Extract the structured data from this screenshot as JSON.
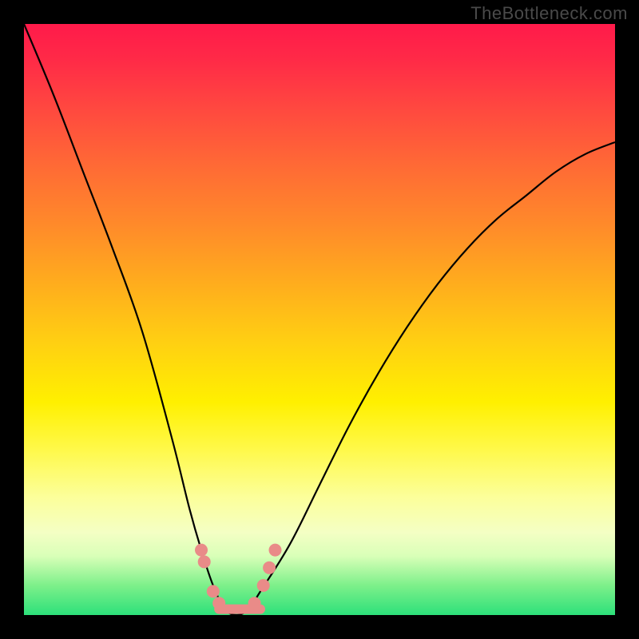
{
  "watermark": "TheBottleneck.com",
  "chart_data": {
    "type": "line",
    "title": "",
    "xlabel": "",
    "ylabel": "",
    "xlim": [
      0,
      100
    ],
    "ylim": [
      0,
      100
    ],
    "grid": false,
    "legend": false,
    "background_gradient": {
      "type": "vertical",
      "top_color": "#ff1a4a",
      "bottom_color": "#2de07a",
      "description": "red-orange-yellow-green heat gradient (top=high bottleneck, bottom=low)"
    },
    "series": [
      {
        "name": "bottleneck-curve",
        "description": "V-shaped bottleneck curve; steep descent on left, broader ascent on right. Minimum near x≈35.",
        "x": [
          0,
          5,
          10,
          15,
          20,
          25,
          28,
          30,
          32,
          34,
          36,
          38,
          40,
          45,
          50,
          55,
          60,
          65,
          70,
          75,
          80,
          85,
          90,
          95,
          100
        ],
        "y": [
          100,
          88,
          75,
          62,
          48,
          30,
          18,
          11,
          5,
          1,
          0,
          1,
          4,
          12,
          22,
          32,
          41,
          49,
          56,
          62,
          67,
          71,
          75,
          78,
          80
        ]
      }
    ],
    "annotations": [
      {
        "type": "points-cluster",
        "name": "highlighted-region",
        "description": "pink/salmon dots marking data points along both flanks near the curve minimum, plus a thick salmon line segment along the trough",
        "points": [
          {
            "x": 30,
            "y": 11
          },
          {
            "x": 30.5,
            "y": 9
          },
          {
            "x": 32,
            "y": 4
          },
          {
            "x": 33,
            "y": 2
          },
          {
            "x": 39,
            "y": 2
          },
          {
            "x": 40.5,
            "y": 5
          },
          {
            "x": 41.5,
            "y": 8
          },
          {
            "x": 42.5,
            "y": 11
          }
        ],
        "trough_line": {
          "x1": 33,
          "y1": 1,
          "x2": 40,
          "y2": 1
        }
      }
    ]
  }
}
